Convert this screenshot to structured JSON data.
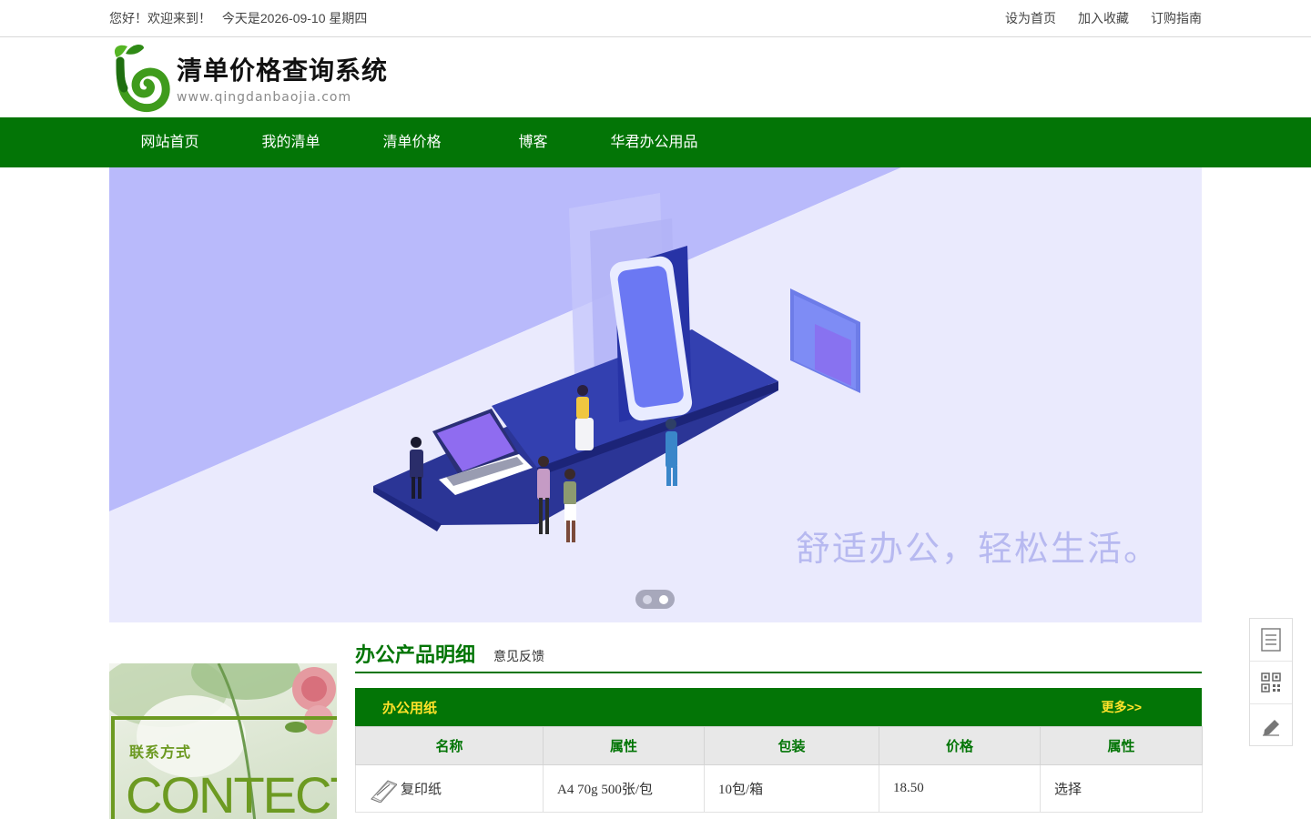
{
  "topbar": {
    "greeting": "您好！欢迎来到！",
    "date": "今天是2026-09-10 星期四",
    "links": [
      "设为首页",
      "加入收藏",
      "订购指南"
    ]
  },
  "header": {
    "title": "清单价格查询系统",
    "url": "www.qingdanbaojia.com"
  },
  "nav": {
    "items": [
      "网站首页",
      "我的清单",
      "清单价格",
      "博客",
      "华君办公用品"
    ]
  },
  "banner": {
    "slogan": "舒适办公，轻松生活。",
    "slides": 2,
    "active_slide": 2
  },
  "contact": {
    "label": "联系方式",
    "big": "CONTECT"
  },
  "main": {
    "title": "办公产品明细",
    "feedback": "意见反馈",
    "category": "办公用纸",
    "more": "更多>>",
    "columns": [
      "名称",
      "属性",
      "包装",
      "价格",
      "属性"
    ],
    "rows": [
      {
        "name": "复印纸",
        "attr": "A4 70g 500张/包",
        "pack": "10包/箱",
        "price": "18.50",
        "action": "选择"
      }
    ]
  },
  "sidetools": [
    "list-icon",
    "qrcode-icon",
    "edit-icon"
  ],
  "colors": {
    "brand_green": "#037506",
    "accent_yellow": "#ffe22a",
    "banner_bg": "#e8e9fd"
  }
}
